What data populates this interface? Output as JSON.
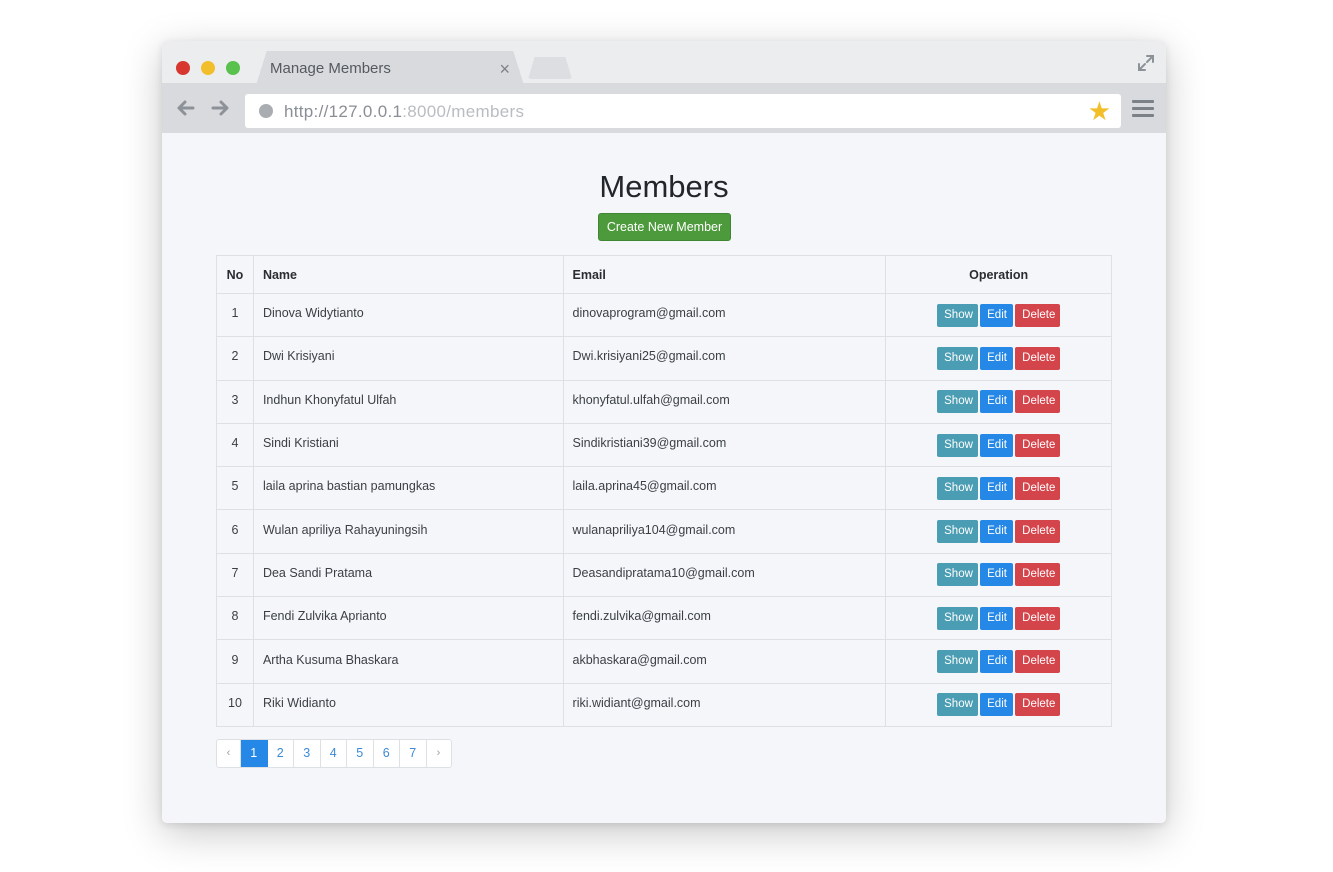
{
  "browser": {
    "tab_title": "Manage Members",
    "tab_close": "×",
    "url_host": "http://127.0.0.1",
    "url_path": ":8000/members"
  },
  "page": {
    "title": "Members",
    "create_button": "Create New Member"
  },
  "table": {
    "headers": {
      "no": "No",
      "name": "Name",
      "email": "Email",
      "operation": "Operation"
    },
    "rows": [
      {
        "no": "1",
        "name": "Dinova Widytianto",
        "email": "dinovaprogram@gmail.com"
      },
      {
        "no": "2",
        "name": "Dwi Krisiyani",
        "email": "Dwi.krisiyani25@gmail.com"
      },
      {
        "no": "3",
        "name": "Indhun Khonyfatul Ulfah",
        "email": "khonyfatul.ulfah@gmail.com"
      },
      {
        "no": "4",
        "name": "Sindi Kristiani",
        "email": "Sindikristiani39@gmail.com"
      },
      {
        "no": "5",
        "name": "laila aprina bastian pamungkas",
        "email": "laila.aprina45@gmail.com"
      },
      {
        "no": "6",
        "name": "Wulan apriliya Rahayuningsih",
        "email": "wulanapriliya104@gmail.com"
      },
      {
        "no": "7",
        "name": "Dea Sandi Pratama",
        "email": "Deasandipratama10@gmail.com"
      },
      {
        "no": "8",
        "name": "Fendi Zulvika Aprianto",
        "email": "fendi.zulvika@gmail.com"
      },
      {
        "no": "9",
        "name": "Artha Kusuma Bhaskara",
        "email": "akbhaskara@gmail.com"
      },
      {
        "no": "10",
        "name": "Riki Widianto",
        "email": "riki.widiant@gmail.com"
      }
    ],
    "actions": {
      "show": "Show",
      "edit": "Edit",
      "delete": "Delete"
    }
  },
  "pagination": {
    "prev": "‹",
    "next": "›",
    "pages": [
      "1",
      "2",
      "3",
      "4",
      "5",
      "6",
      "7"
    ],
    "active": "1"
  },
  "icons": {
    "back": "arrow-left-icon",
    "forward": "arrow-right-icon",
    "star": "★",
    "menu": "hamburger-menu-icon",
    "expand": "expand-icon"
  },
  "colors": {
    "create_button": "#4c9a3b",
    "show_button": "#4a9db3",
    "edit_button": "#2588e6",
    "delete_button": "#d3454b",
    "pagination_active": "#2588e6"
  }
}
